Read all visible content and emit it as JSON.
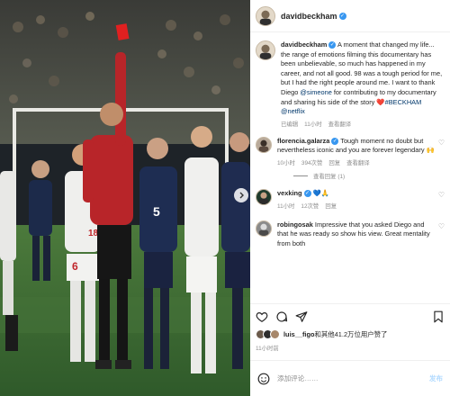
{
  "header": {
    "username": "davidbeckham"
  },
  "caption": {
    "username": "davidbeckham",
    "text_1": "A moment that changed my life... the range of emotions filming this documentary has been unbelievable, so much has happened in my career, and not all good. 98 was a tough period for me, but I had the right people around me. I want to thank Diego ",
    "mention_1": "@simeone",
    "text_2": " for contributing to my documentary and sharing his side of the story ",
    "heart_emoji": "❤️",
    "hashtag": "#BECKHAM",
    "mention_2": "@netflix",
    "meta_status": "已编辑",
    "meta_time": "11小时",
    "meta_translate": "查看翻译"
  },
  "comments": [
    {
      "username": "florencia.galarza",
      "text": "Tough moment no doubt but nevertheless iconic and you are forever legendary 🙌",
      "time": "10小时",
      "likes": "394次赞",
      "reply": "回复",
      "translate": "查看翻译",
      "view_replies": "查看回复 (1)"
    },
    {
      "username": "vexking",
      "text": "💙🙏",
      "time": "11小时",
      "likes": "12次赞",
      "reply": "回复"
    },
    {
      "username": "robingosak",
      "text": "Impressive that you asked Diego and that he was ready so show his view. Great mentality from both"
    }
  ],
  "likes_line": {
    "username": "luis__figo",
    "rest": "和其他41.2万位用户赞了"
  },
  "post_time": "11小时前",
  "add_comment": {
    "placeholder": "添加评论……",
    "post_label": "发布"
  },
  "colors": {
    "verified": "#3897f0",
    "link": "#00376b",
    "referee_shirt": "#c0262b",
    "red_card": "#e02020",
    "pitch": "#3f6a35"
  }
}
